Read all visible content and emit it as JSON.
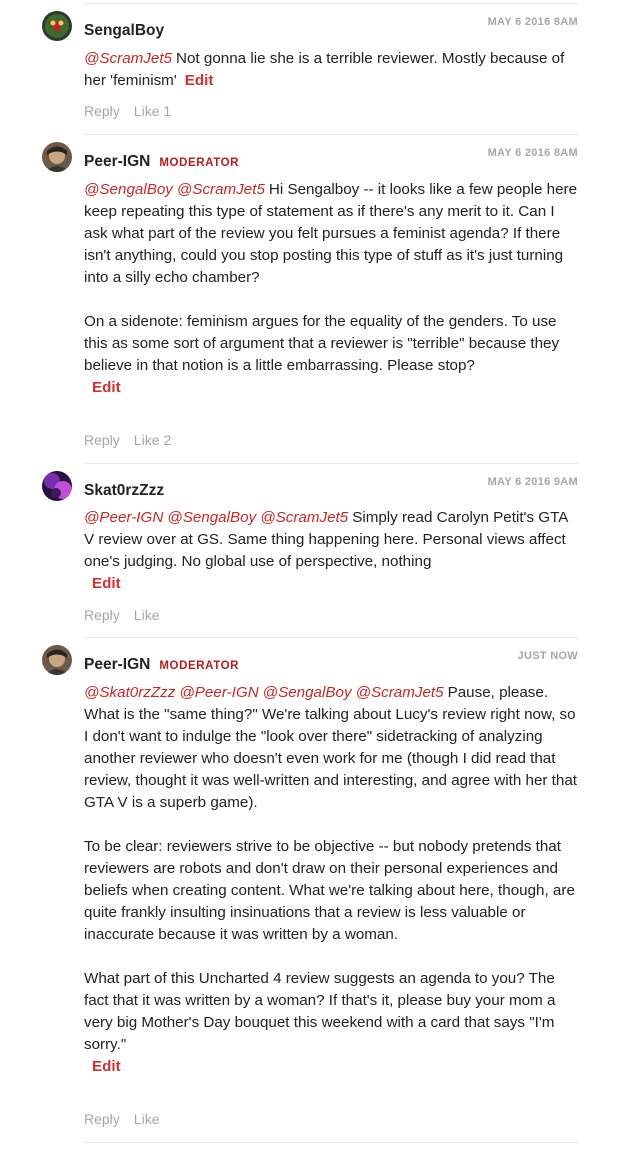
{
  "comments": [
    {
      "username": "SengalBoy",
      "badge": "",
      "timestamp": "MAY 6 2016 8AM",
      "mentions": [
        "@ScramJet5"
      ],
      "paragraphs": [
        "Not gonna lie she is a terrible reviewer. Mostly because of her 'feminism'"
      ],
      "edit_label": "Edit",
      "reply_label": "Reply",
      "like_label": "Like 1"
    },
    {
      "username": "Peer-IGN",
      "badge": "MODERATOR",
      "timestamp": "MAY 6 2016 8AM",
      "mentions": [
        "@SengalBoy",
        "@ScramJet5"
      ],
      "paragraphs": [
        "Hi Sengalboy -- it looks like a few people here keep repeating this type of statement as if there's any merit to it. Can I ask what part of the review you felt pursues a feminist agenda? If there isn't anything, could you stop posting this type of stuff as it's just turning into a silly echo chamber?",
        "On a sidenote: feminism argues for the equality of the genders. To use this as some sort of argument that a reviewer is \"terrible\" because they believe in that notion is a little embarrassing.  Please stop?"
      ],
      "edit_label": "Edit",
      "reply_label": "Reply",
      "like_label": "Like 2"
    },
    {
      "username": "Skat0rzZzz",
      "badge": "",
      "timestamp": "MAY 6 2016 9AM",
      "mentions": [
        "@Peer-IGN",
        "@SengalBoy",
        "@ScramJet5"
      ],
      "paragraphs": [
        "Simply read Carolyn Petit's GTA V review over at GS. Same thing happening here. Personal views affect one's judging. No global use of perspective, nothing"
      ],
      "edit_label": "Edit",
      "reply_label": "Reply",
      "like_label": "Like"
    },
    {
      "username": "Peer-IGN",
      "badge": "MODERATOR",
      "timestamp": "JUST NOW",
      "mentions": [
        "@Skat0rzZzz",
        "@Peer-IGN",
        "@SengalBoy",
        "@ScramJet5"
      ],
      "paragraphs": [
        "Pause, please. What is the \"same thing?\" We're talking about Lucy's review right now, so I don't want to indulge the \"look over there\" sidetracking of analyzing another reviewer who doesn't even work for me (though I did read that review, thought it was well-written and interesting, and agree with her that GTA V is a superb game).",
        "To be clear: reviewers strive to be objective -- but nobody pretends that reviewers are robots and don't draw on their personal experiences and beliefs when creating content. What we're talking about here, though, are quite frankly insulting insinuations that a review is less valuable or inaccurate because it was written by a woman.",
        "What part of this Uncharted 4 review suggests an agenda to you? The fact that it was written by a woman? If that's it, please buy your mom a very big Mother's Day bouquet this weekend with a card that says \"I'm sorry.\""
      ],
      "edit_label": "Edit",
      "reply_label": "Reply",
      "like_label": "Like"
    }
  ]
}
